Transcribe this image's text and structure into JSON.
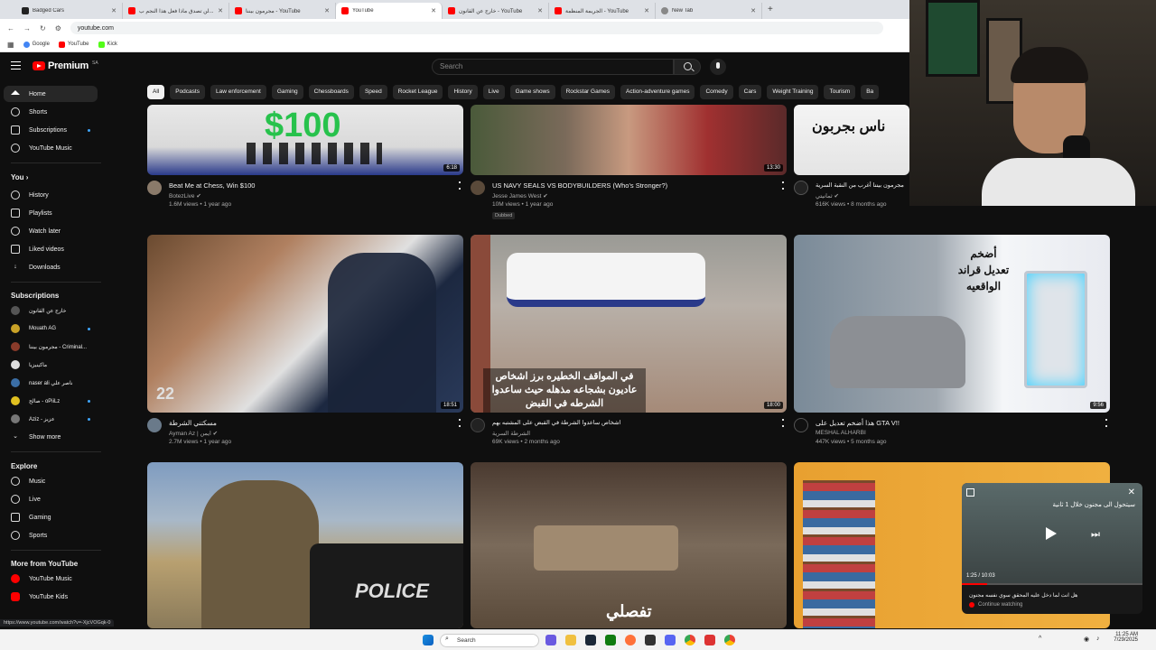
{
  "browser": {
    "tabs": [
      {
        "title": "Badged Cars",
        "color": "#222"
      },
      {
        "title": "لن تصدق ماذا فعل هذا النجم ب...",
        "color": "#f00"
      },
      {
        "title": "مجرمون بيننا - YouTube",
        "color": "#f00"
      },
      {
        "title": "YouTube",
        "color": "#f00"
      },
      {
        "title": "خارج عن القانون - YouTube",
        "color": "#f00"
      },
      {
        "title": "الجريمة المنظمة - YouTube",
        "color": "#f00"
      },
      {
        "title": "New Tab",
        "color": "#888"
      }
    ],
    "url": "youtube.com",
    "bookmarks": [
      {
        "label": "Google",
        "color": "#4285f4"
      },
      {
        "label": "YouTube",
        "color": "#f00"
      },
      {
        "label": "Kick",
        "color": "#53fc18"
      }
    ],
    "status_url": "https://www.youtube.com/watch?v=-XjcVOGqk-0"
  },
  "header": {
    "logo": "Premium",
    "logo_sup": "SA",
    "search_placeholder": "Search"
  },
  "sidebar": {
    "main": [
      "Home",
      "Shorts",
      "Subscriptions",
      "YouTube Music"
    ],
    "you_heading": "You",
    "you_items": [
      "History",
      "Playlists",
      "Watch later",
      "Liked videos",
      "Downloads"
    ],
    "subs_heading": "Subscriptions",
    "subs": [
      {
        "name": "خارج عن القانون",
        "color": "#555"
      },
      {
        "name": "Mouath AG",
        "color": "#c9a227"
      },
      {
        "name": "مجرمون بيننا - Criminal...",
        "color": "#8a3b2a"
      },
      {
        "name": "ماكينيزيا",
        "color": "#ddd"
      },
      {
        "name": "naser ali ناصر علي",
        "color": "#3b6ea5"
      },
      {
        "name": "صالح - oPiiLz",
        "color": "#e0c020"
      },
      {
        "name": "Aziz - عزيز",
        "color": "#777"
      }
    ],
    "show_more": "Show more",
    "explore_heading": "Explore",
    "explore": [
      "Music",
      "Live",
      "Gaming",
      "Sports"
    ],
    "more_heading": "More from YouTube",
    "more": [
      "YouTube Music",
      "YouTube Kids"
    ]
  },
  "chips": [
    "All",
    "Podcasts",
    "Law enforcement",
    "Gaming",
    "Chessboards",
    "Speed",
    "Rocket League",
    "History",
    "Live",
    "Game shows",
    "Rockstar Games",
    "Action-adventure games",
    "Comedy",
    "Cars",
    "Weight Training",
    "Tourism",
    "Ba"
  ],
  "videos_row1": [
    {
      "title": "Beat Me at Chess, Win $100",
      "channel": "BotezLive",
      "meta": "1.6M views • 1 year ago",
      "duration": "6:18",
      "thumb_text": "$100",
      "badge": ""
    },
    {
      "title": "US NAVY SEALS VS BODYBUILDERS (Who's Stronger?)",
      "channel": "Jesse James West",
      "meta": "10M views • 1 year ago",
      "duration": "13:30",
      "thumb_text": "",
      "badge": "Dubbed"
    },
    {
      "title": "مجرمون بيننا أغرب من النقبة السرية",
      "channel": "ثمانيتي",
      "meta": "616K views • 8 months ago",
      "duration": "",
      "thumb_text": "ناس بجربون",
      "badge": ""
    }
  ],
  "videos_row2": [
    {
      "title": "مسكتني الشرطة",
      "channel": "Ayman Az | ايمن",
      "meta": "2.7M views • 1 year ago",
      "duration": "18:51",
      "thumb_text": ""
    },
    {
      "title": "اشخاص ساعدوا الشرطة في القبض على المشتبه بهم",
      "channel": "الشرطة السرية",
      "meta": "69K views • 2 months ago",
      "duration": "18:00",
      "thumb_text": "في المواقف الخطيره برز اشخاص عاديون بشجاعه مذهله حيث ساعدوا الشرطه في القبض"
    },
    {
      "title": "هذا أضخم تعديل على GTA V!!",
      "channel": "MESHAL ALHARBI",
      "meta": "447K views • 5 months ago",
      "duration": "9:56",
      "thumb_text": "أضخم تعديل قراند الواقعيه"
    }
  ],
  "videos_row3": [
    {
      "thumb_text": "POLICE"
    },
    {
      "thumb_text": "تفصلي"
    },
    {
      "thumb_text": ""
    }
  ],
  "miniplayer": {
    "countdown": "سيتحول الى مجنون خلال 1 ثانية",
    "time": "1:25 / 10:03",
    "title": "هل انت لما دخل عليه المحقق سوي نفسه مجنون",
    "continue": "Continue watching"
  },
  "taskbar": {
    "search": "Search",
    "time": "11:25 AM",
    "date": "7/29/2025"
  }
}
